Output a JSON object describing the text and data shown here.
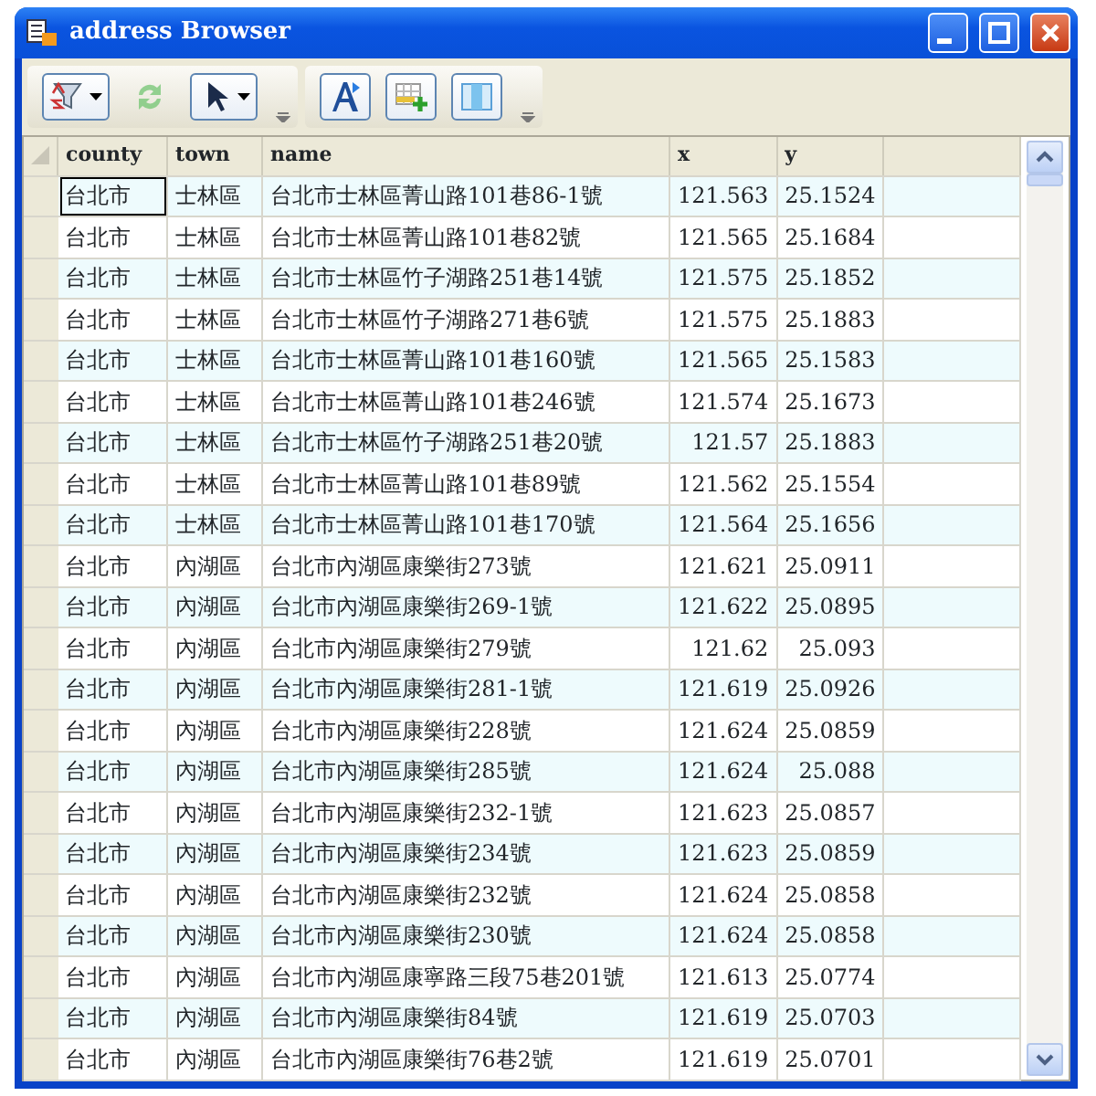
{
  "window": {
    "title": "address Browser"
  },
  "toolbar": {
    "groups": [
      [
        {
          "dropdown": true,
          "disabled": false
        },
        {
          "dropdown": false,
          "disabled": true
        },
        {
          "dropdown": true,
          "disabled": false
        }
      ],
      [
        {
          "dropdown": false,
          "disabled": false
        },
        {
          "dropdown": false,
          "disabled": false
        },
        {
          "dropdown": false,
          "disabled": false
        }
      ]
    ]
  },
  "table": {
    "columns": [
      "county",
      "town",
      "name",
      "x",
      "y"
    ],
    "rows": [
      {
        "cells": [
          "台北市",
          "士林區",
          "台北市士林區菁山路101巷86-1號",
          "121.563",
          "25.1524"
        ],
        "current": true
      },
      {
        "cells": [
          "台北市",
          "士林區",
          "台北市士林區菁山路101巷82號",
          "121.565",
          "25.1684"
        ],
        "current": false
      },
      {
        "cells": [
          "台北市",
          "士林區",
          "台北市士林區竹子湖路251巷14號",
          "121.575",
          "25.1852"
        ],
        "current": false
      },
      {
        "cells": [
          "台北市",
          "士林區",
          "台北市士林區竹子湖路271巷6號",
          "121.575",
          "25.1883"
        ],
        "current": false
      },
      {
        "cells": [
          "台北市",
          "士林區",
          "台北市士林區菁山路101巷160號",
          "121.565",
          "25.1583"
        ],
        "current": false
      },
      {
        "cells": [
          "台北市",
          "士林區",
          "台北市士林區菁山路101巷246號",
          "121.574",
          "25.1673"
        ],
        "current": false
      },
      {
        "cells": [
          "台北市",
          "士林區",
          "台北市士林區竹子湖路251巷20號",
          "121.57",
          "25.1883"
        ],
        "current": false
      },
      {
        "cells": [
          "台北市",
          "士林區",
          "台北市士林區菁山路101巷89號",
          "121.562",
          "25.1554"
        ],
        "current": false
      },
      {
        "cells": [
          "台北市",
          "士林區",
          "台北市士林區菁山路101巷170號",
          "121.564",
          "25.1656"
        ],
        "current": false
      },
      {
        "cells": [
          "台北市",
          "內湖區",
          "台北市內湖區康樂街273號",
          "121.621",
          "25.0911"
        ],
        "current": false
      },
      {
        "cells": [
          "台北市",
          "內湖區",
          "台北市內湖區康樂街269-1號",
          "121.622",
          "25.0895"
        ],
        "current": false
      },
      {
        "cells": [
          "台北市",
          "內湖區",
          "台北市內湖區康樂街279號",
          "121.62",
          "25.093"
        ],
        "current": false
      },
      {
        "cells": [
          "台北市",
          "內湖區",
          "台北市內湖區康樂街281-1號",
          "121.619",
          "25.0926"
        ],
        "current": false
      },
      {
        "cells": [
          "台北市",
          "內湖區",
          "台北市內湖區康樂街228號",
          "121.624",
          "25.0859"
        ],
        "current": false
      },
      {
        "cells": [
          "台北市",
          "內湖區",
          "台北市內湖區康樂街285號",
          "121.624",
          "25.088"
        ],
        "current": false
      },
      {
        "cells": [
          "台北市",
          "內湖區",
          "台北市內湖區康樂街232-1號",
          "121.623",
          "25.0857"
        ],
        "current": false
      },
      {
        "cells": [
          "台北市",
          "內湖區",
          "台北市內湖區康樂街234號",
          "121.623",
          "25.0859"
        ],
        "current": false
      },
      {
        "cells": [
          "台北市",
          "內湖區",
          "台北市內湖區康樂街232號",
          "121.624",
          "25.0858"
        ],
        "current": false
      },
      {
        "cells": [
          "台北市",
          "內湖區",
          "台北市內湖區康樂街230號",
          "121.624",
          "25.0858"
        ],
        "current": false
      },
      {
        "cells": [
          "台北市",
          "內湖區",
          "台北市內湖區康寧路三段75巷201號",
          "121.613",
          "25.0774"
        ],
        "current": false
      },
      {
        "cells": [
          "台北市",
          "內湖區",
          "台北市內湖區康樂街84號",
          "121.619",
          "25.0703"
        ],
        "current": false
      },
      {
        "cells": [
          "台北市",
          "內湖區",
          "台北市內湖區康樂街76巷2號",
          "121.619",
          "25.0701"
        ],
        "current": false
      }
    ]
  }
}
